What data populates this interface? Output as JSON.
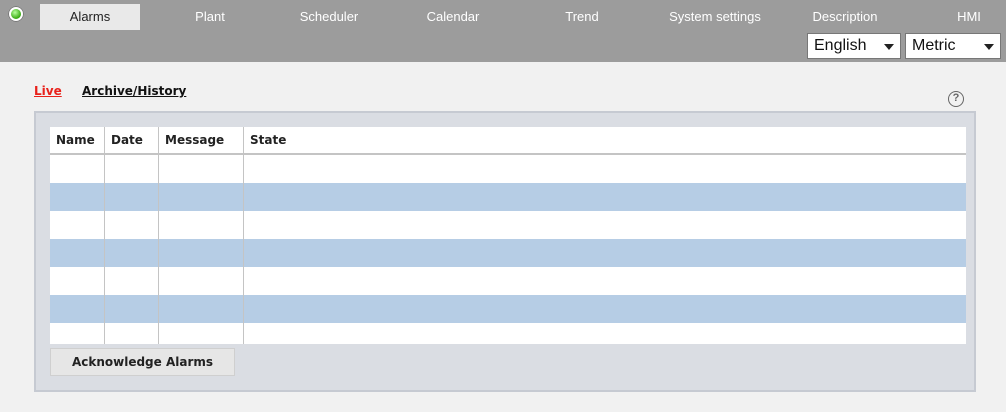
{
  "nav": {
    "tabs": [
      {
        "label": "Alarms",
        "active": true
      },
      {
        "label": "Plant"
      },
      {
        "label": "Scheduler"
      },
      {
        "label": "Calendar"
      },
      {
        "label": "Trend"
      },
      {
        "label": "System settings"
      },
      {
        "label": "Description"
      },
      {
        "label": "HMI"
      }
    ],
    "status_icon": "green-status-light"
  },
  "language_select": {
    "value": "English"
  },
  "units_select": {
    "value": "Metric"
  },
  "subnav": {
    "live": "Live",
    "archive": "Archive/History",
    "live_color": "#e8211b"
  },
  "help": {
    "icon": "question-circle-icon",
    "glyph": "?"
  },
  "alarms_table": {
    "columns": [
      "Name",
      "Date",
      "Message",
      "State"
    ],
    "rows": [
      [
        "",
        "",
        "",
        ""
      ],
      [
        "",
        "",
        "",
        ""
      ],
      [
        "",
        "",
        "",
        ""
      ],
      [
        "",
        "",
        "",
        ""
      ],
      [
        "",
        "",
        "",
        ""
      ],
      [
        "",
        "",
        "",
        ""
      ],
      [
        "",
        "",
        "",
        ""
      ]
    ],
    "alt_row_color": "#b6cde5"
  },
  "actions": {
    "acknowledge": "Acknowledge Alarms"
  }
}
